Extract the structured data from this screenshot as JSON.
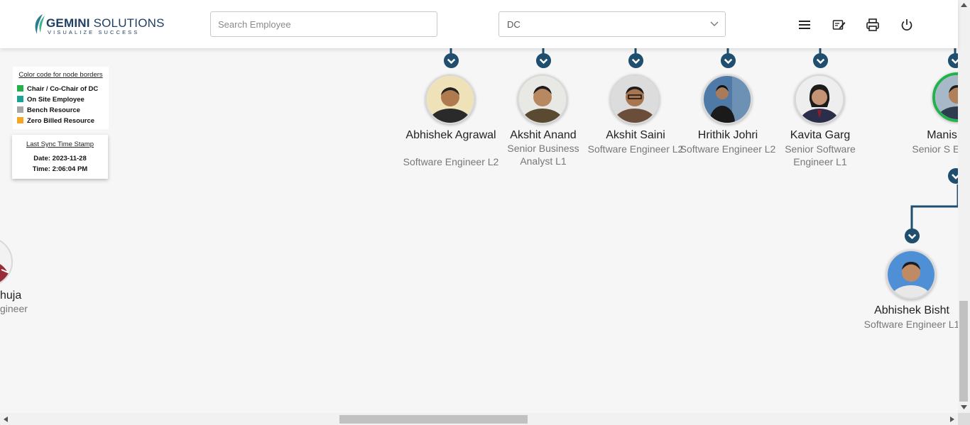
{
  "header": {
    "logo": {
      "brand_bold": "GEMINI",
      "brand_rest": "SOLUTIONS",
      "tagline": "VISUALIZE SUCCESS"
    },
    "search": {
      "placeholder": "Search Employee",
      "value": ""
    },
    "filter": {
      "selected": "DC"
    },
    "icons": [
      "menu-icon",
      "edit-note-icon",
      "print-icon",
      "power-icon"
    ]
  },
  "legend": {
    "title": "Color code for node borders",
    "items": [
      {
        "label": "Chair / Co-Chair of DC",
        "color": "#22b14c"
      },
      {
        "label": "On Site Employee",
        "color": "#1aa394"
      },
      {
        "label": "Bench Resource",
        "color": "#a6a6a6"
      },
      {
        "label": "Zero Billed Resource",
        "color": "#f5a623"
      }
    ]
  },
  "sync": {
    "title": "Last Sync Time Stamp",
    "date": "Date: 2023-11-28",
    "time": "Time: 2:06:04 PM"
  },
  "employees": [
    {
      "name": "Abhishek Agrawal",
      "title": "Software Engineer L2"
    },
    {
      "name": "Akshit Anand",
      "title": "Senior Business Analyst L1"
    },
    {
      "name": "Akshit Saini",
      "title": "Software Engineer L2"
    },
    {
      "name": "Hrithik Johri",
      "title": "Software Engineer L2"
    },
    {
      "name": "Kavita Garg",
      "title": "Senior Software Engineer L1"
    },
    {
      "name": "Manish",
      "title": "Senior S Engine"
    },
    {
      "name": "Abhishek Bisht",
      "title": "Software Engineer L1"
    },
    {
      "name": "huja",
      "title": "gineer"
    }
  ],
  "colors": {
    "connector": "#1f4e6e",
    "chair_border": "#22b14c"
  }
}
